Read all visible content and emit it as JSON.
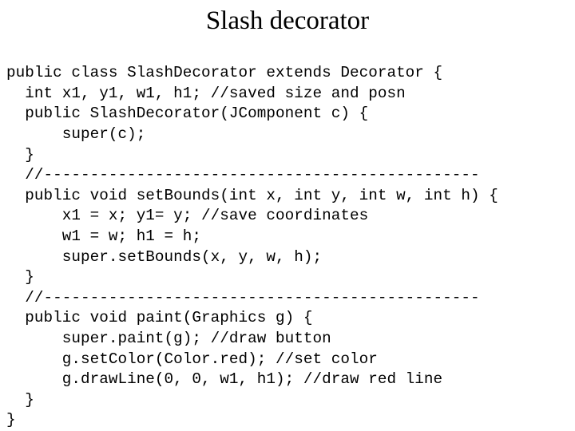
{
  "slide": {
    "title": "Slash decorator",
    "background_color": "#ffffff",
    "text_color": "#000000",
    "code": {
      "language": "java",
      "lines": [
        "public class SlashDecorator extends Decorator {",
        "  int x1, y1, w1, h1; //saved size and posn",
        "  public SlashDecorator(JComponent c) {",
        "      super(c);",
        "  }",
        "  //-----------------------------------------------",
        "  public void setBounds(int x, int y, int w, int h) {",
        "      x1 = x; y1= y; //save coordinates",
        "      w1 = w; h1 = h;",
        "      super.setBounds(x, y, w, h);",
        "  }",
        "  //-----------------------------------------------",
        "  public void paint(Graphics g) {",
        "      super.paint(g); //draw button",
        "      g.setColor(Color.red); //set color",
        "      g.drawLine(0, 0, w1, h1); //draw red line",
        "  }",
        "}"
      ]
    }
  }
}
